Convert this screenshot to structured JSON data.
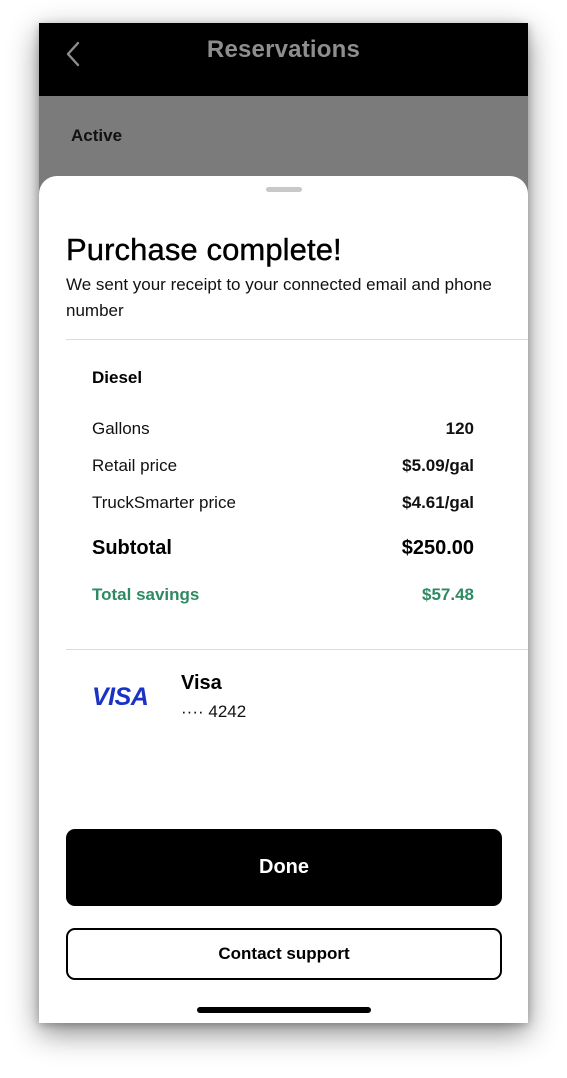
{
  "nav": {
    "title": "Reservations",
    "back_icon": "chevron-left-icon"
  },
  "background": {
    "section_label": "Active"
  },
  "sheet": {
    "title": "Purchase complete!",
    "subtitle": "We sent your receipt to your connected email and phone number",
    "fuel_type": "Diesel",
    "rows": [
      {
        "label": "Gallons",
        "value": "120"
      },
      {
        "label": "Retail price",
        "value": "$5.09/gal"
      },
      {
        "label": "TruckSmarter price",
        "value": "$4.61/gal"
      }
    ],
    "subtotal": {
      "label": "Subtotal",
      "value": "$250.00"
    },
    "savings": {
      "label": "Total savings",
      "value": "$57.48"
    },
    "payment": {
      "logo_text": "VISA",
      "card_name": "Visa",
      "card_number": "···· 4242"
    },
    "done_label": "Done",
    "support_label": "Contact support"
  },
  "colors": {
    "savings_green": "#2f8a63",
    "visa_blue": "#1a33c4",
    "primary_black": "#000000"
  }
}
